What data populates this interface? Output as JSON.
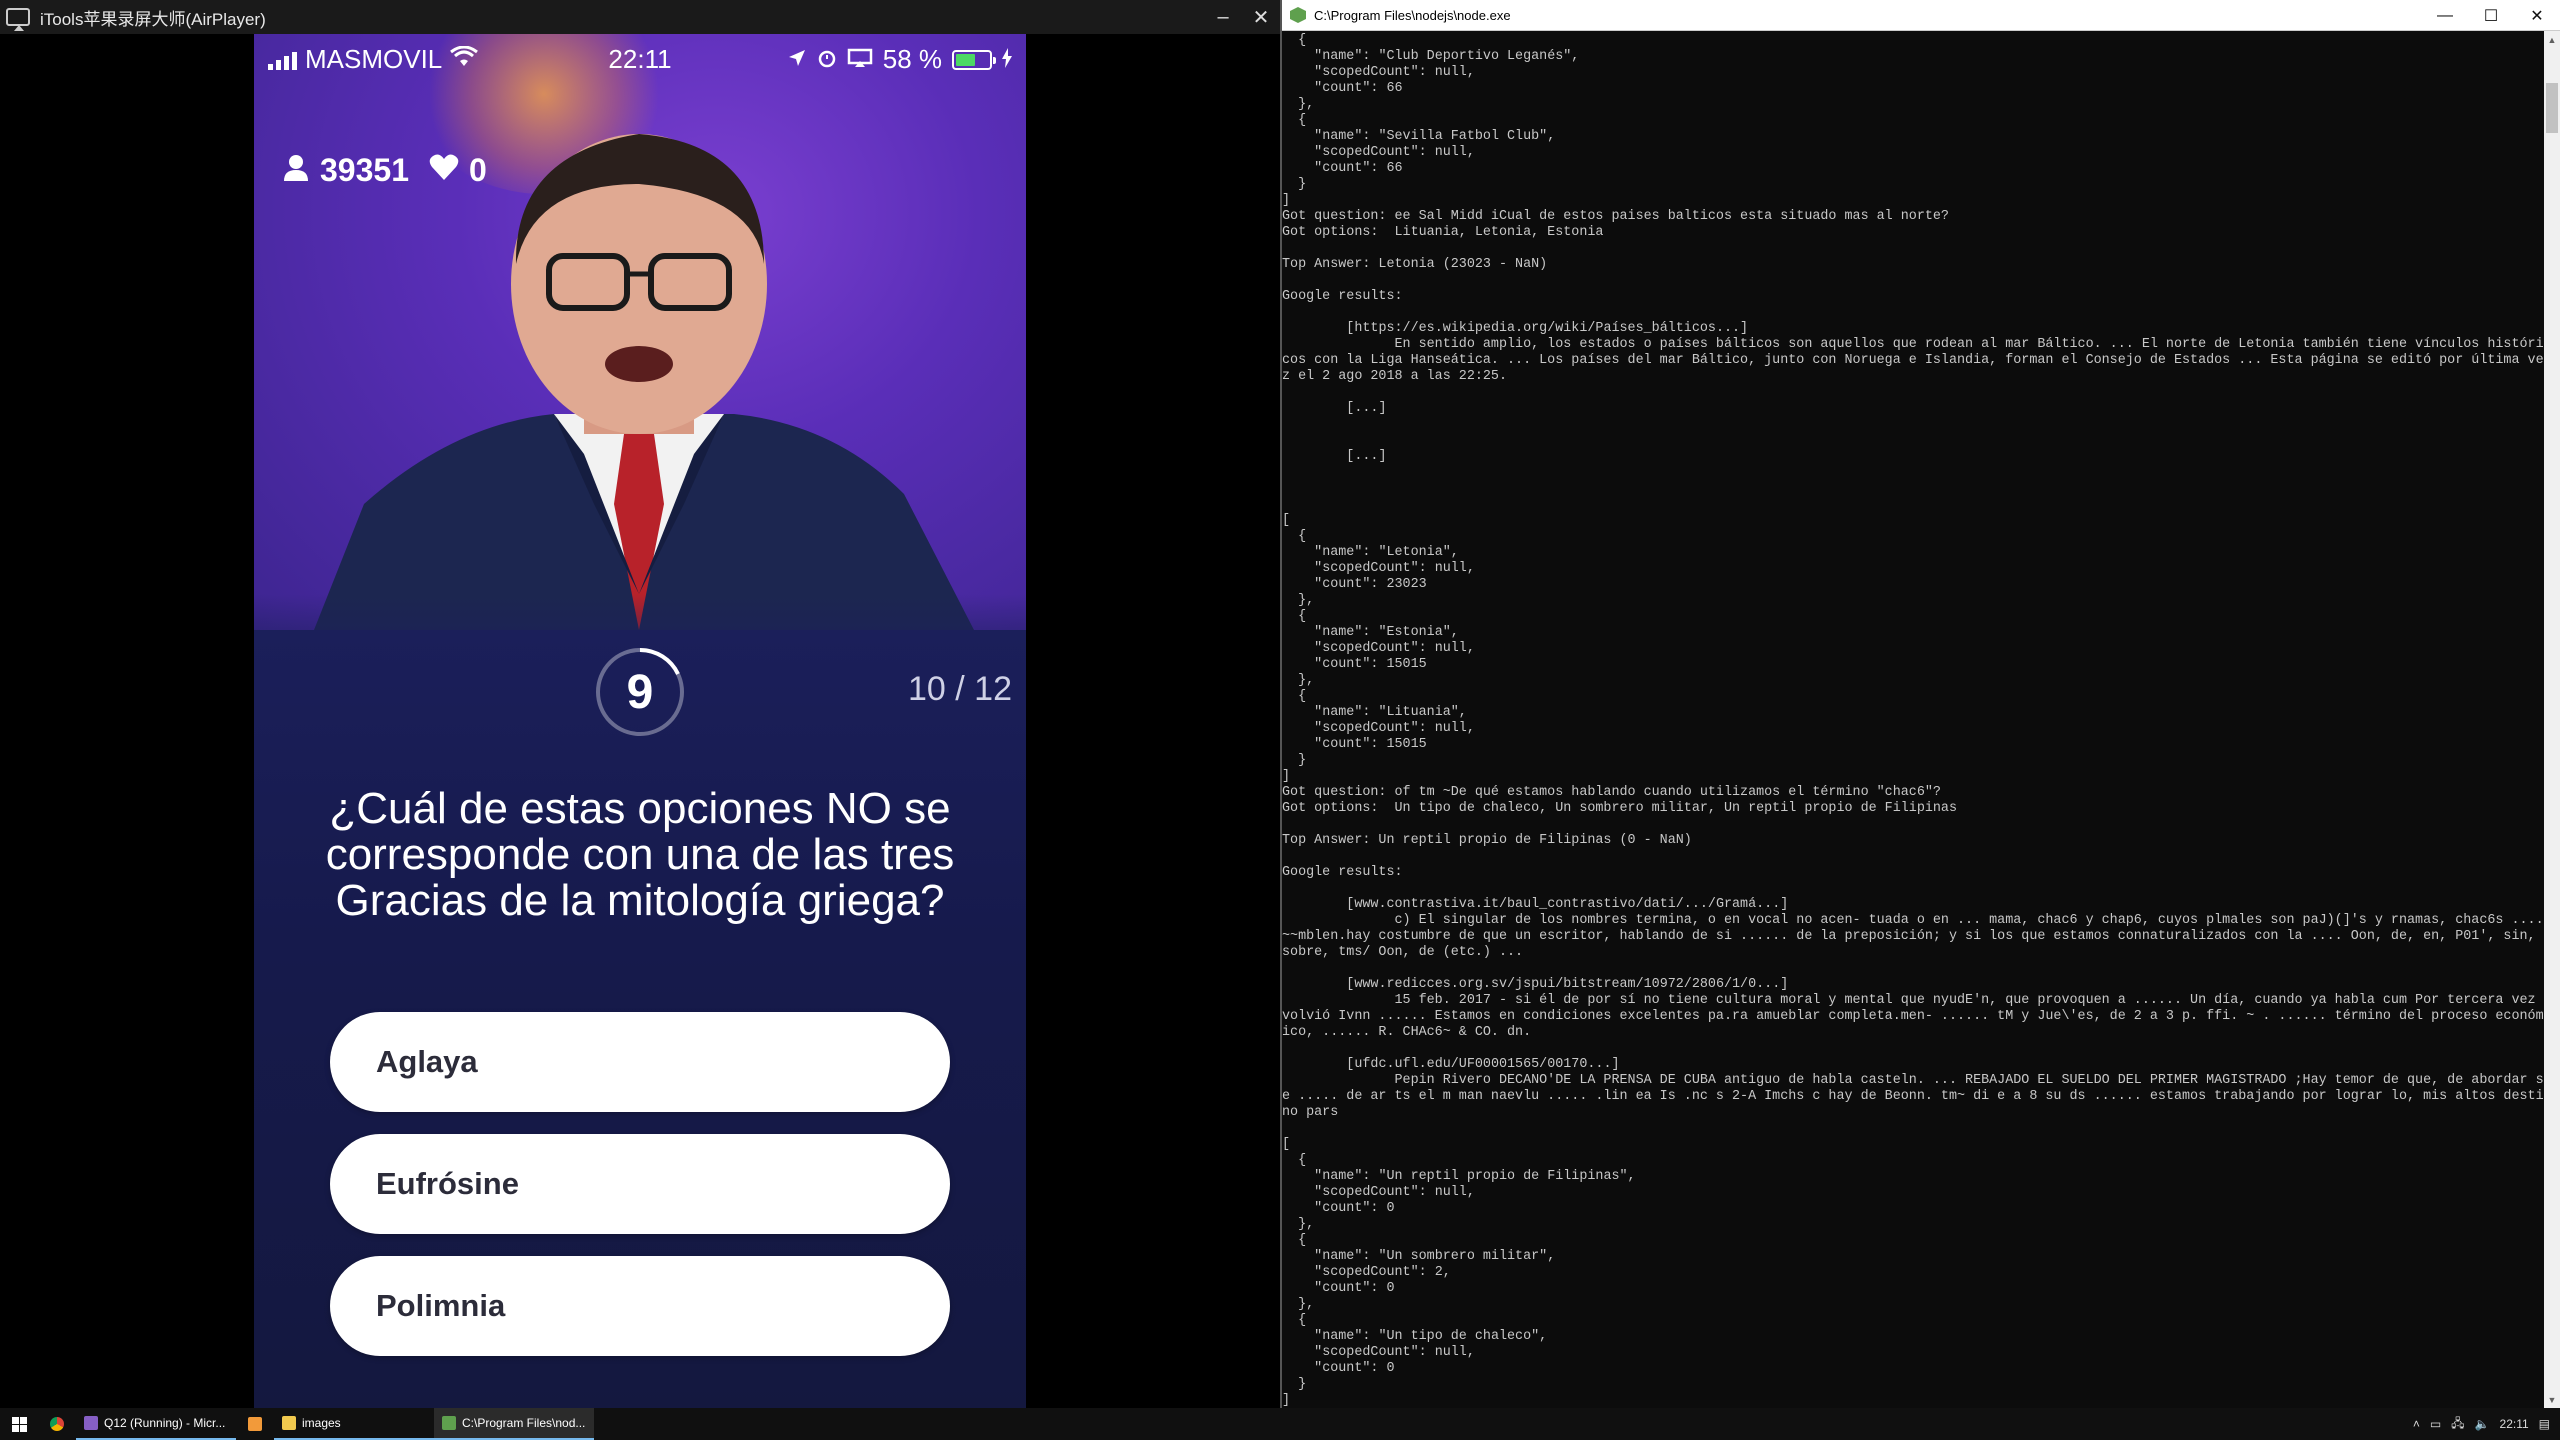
{
  "left_window": {
    "title": "iTools苹果录屏大师(AirPlayer)",
    "controls": {
      "minimize": "–",
      "close": "✕"
    }
  },
  "phone": {
    "status": {
      "carrier": "MASMOVIL",
      "time": "22:11",
      "battery_text": "58 %",
      "battery_level": 0.58
    },
    "players": "39351",
    "lives": "0",
    "timer": "9",
    "progress": "10 / 12",
    "question": "¿Cuál de estas opciones NO se corresponde con una de las tres Gracias de la mitología griega?",
    "answers": [
      "Aglaya",
      "Eufrósine",
      "Polimnia"
    ]
  },
  "console": {
    "title": "C:\\Program Files\\nodejs\\node.exe",
    "output": "  {\n    \"name\": \"Club Deportivo Leganés\",\n    \"scopedCount\": null,\n    \"count\": 66\n  },\n  {\n    \"name\": \"Sevilla Fatbol Club\",\n    \"scopedCount\": null,\n    \"count\": 66\n  }\n]\nGot question: ee Sal Midd iCual de estos paises balticos esta situado mas al norte?\nGot options:  Lituania, Letonia, Estonia\n\nTop Answer: Letonia (23023 - NaN)\n\nGoogle results:\n\n        [https://es.wikipedia.org/wiki/Países_bálticos...]\n              En sentido amplio, los estados o países bálticos son aquellos que rodean al mar Báltico. ... El norte de Letonia también tiene vínculos históricos con la Liga Hanseática. ... Los países del mar Báltico, junto con Noruega e Islandia, forman el Consejo de Estados ... Esta página se editó por última vez el 2 ago 2018 a las 22:25.\n\n        [...]\n\n\n        [...]\n\n\n\n[\n  {\n    \"name\": \"Letonia\",\n    \"scopedCount\": null,\n    \"count\": 23023\n  },\n  {\n    \"name\": \"Estonia\",\n    \"scopedCount\": null,\n    \"count\": 15015\n  },\n  {\n    \"name\": \"Lituania\",\n    \"scopedCount\": null,\n    \"count\": 15015\n  }\n]\nGot question: of tm ~De qué estamos hablando cuando utilizamos el término \"chac6\"?\nGot options:  Un tipo de chaleco, Un sombrero militar, Un reptil propio de Filipinas\n\nTop Answer: Un reptil propio de Filipinas (0 - NaN)\n\nGoogle results:\n\n        [www.contrastiva.it/baul_contrastivo/dati/.../Gramá...]\n              c) El singular de los nombres termina, o en vocal no acen- tuada o en ... mama, chac6 y chap6, cuyos plmales son paJ)(]'s y rnamas, chac6s .... ~~mblen.hay costumbre de que un escritor, hablando de si ...... de la preposición; y si los que estamos connaturalizados con la .... Oon, de, en, P01', sin, sobre, tms/ Oon, de (etc.) ...\n\n        [www.redicces.org.sv/jspui/bitstream/10972/2806/1/0...]\n              15 feb. 2017 - si él de por sí no tiene cultura moral y mental que nyudE'n, que provoquen a ...... Un día, cuando ya habla cum Por tercera vez volvió Ivnn ...... Estamos en condiciones excelentes pa.ra amueblar completa.men- ...... tM y Jue\\'es, de 2 a 3 p. ffi. ~ . ...... término del proceso económico, ...... R. CHAc6~ & CO. dn.\n\n        [ufdc.ufl.edu/UF00001565/00170...]\n              Pepin Rivero DECANO'DE LA PRENSA DE CUBA antiguo de habla casteln. ... REBAJADO EL SUELDO DEL PRIMER MAGISTRADO ;Hay temor de que, de abordar se ..... de ar ts el m man naevlu ..... .lin ea Is .nc s 2-A Imchs c hay de Beonn. tm~ di e a 8 su ds ...... estamos trabajando por lograr lo, mis altos destino pars\n\n[\n  {\n    \"name\": \"Un reptil propio de Filipinas\",\n    \"scopedCount\": null,\n    \"count\": 0\n  },\n  {\n    \"name\": \"Un sombrero militar\",\n    \"scopedCount\": 2,\n    \"count\": 0\n  },\n  {\n    \"name\": \"Un tipo de chaleco\",\n    \"scopedCount\": null,\n    \"count\": 0\n  }\n]"
  },
  "taskbar": {
    "items": [
      "Q12 (Running) - Micr...",
      "images",
      "C:\\Program Files\\nod..."
    ],
    "clock": "22:11"
  },
  "colors": {
    "video_purple": "#5a2eb8",
    "panel_navy": "#161a4c",
    "console_bg": "#0c0c0c",
    "console_text": "#c8c8c8",
    "battery_green": "#4cd964"
  }
}
